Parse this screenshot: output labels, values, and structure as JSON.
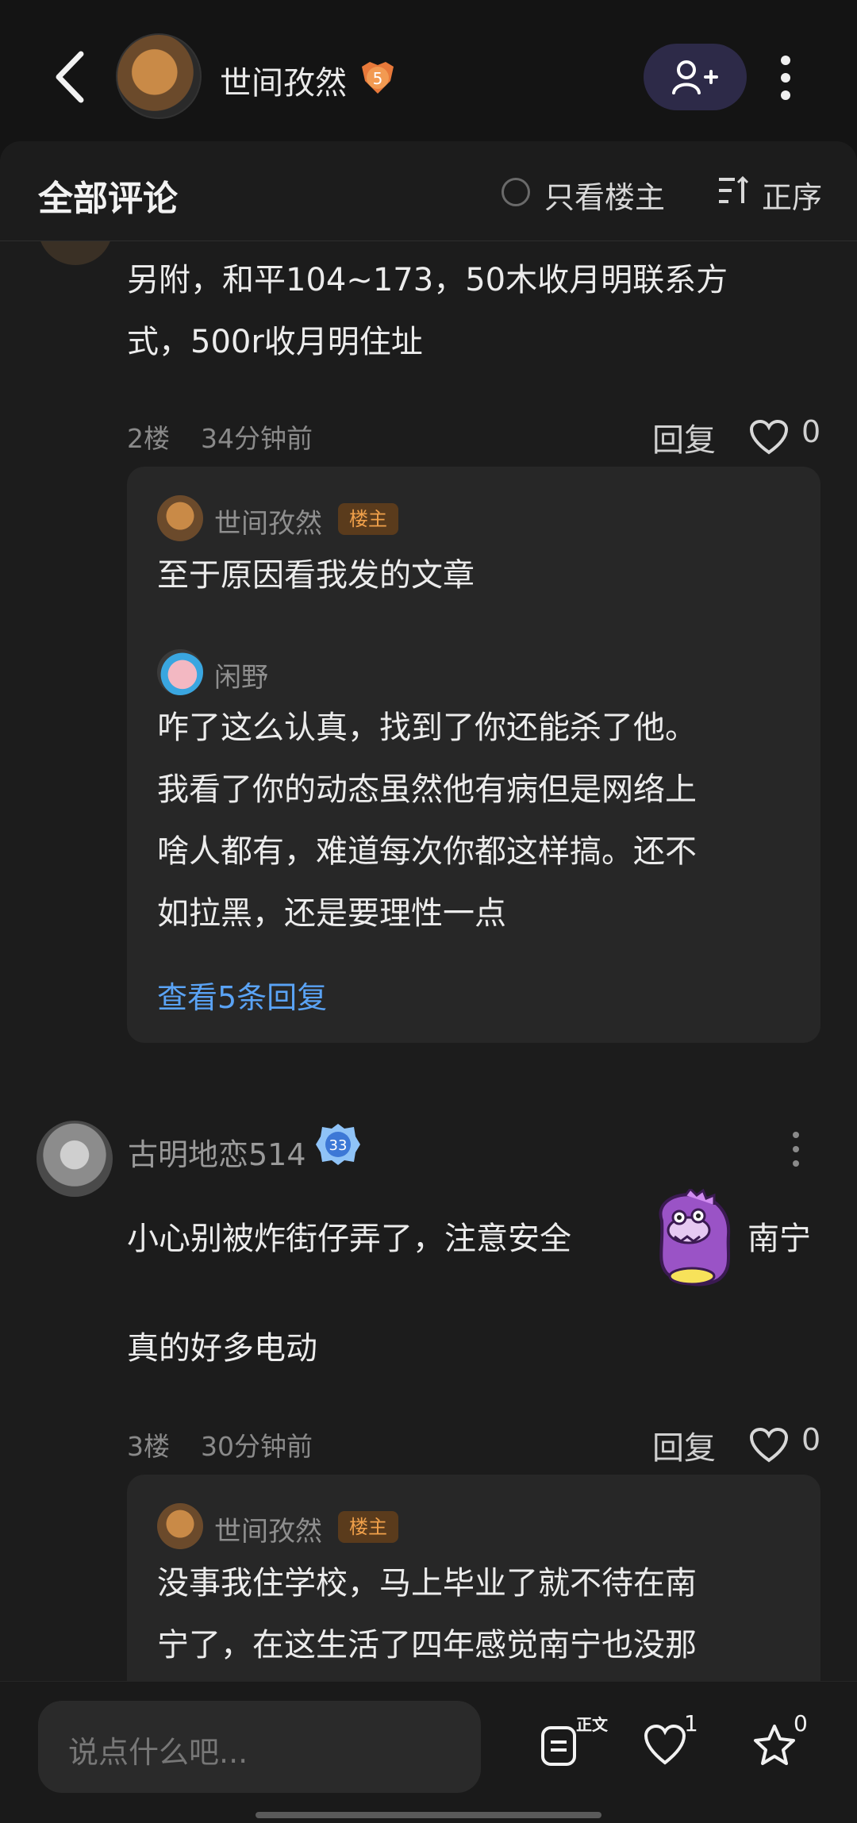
{
  "header": {
    "author_name": "世间孜然",
    "author_level": "5"
  },
  "comments_sheet": {
    "title": "全部评论",
    "only_op_label": "只看楼主",
    "sort_label": "正序"
  },
  "comments": [
    {
      "text_lines": [
        "另附，和平104~173，50木收月明联系方",
        "式，500r收月明住址"
      ],
      "floor": "2楼",
      "time": "34分钟前",
      "reply_label": "回复",
      "likes": "0",
      "replies": [
        {
          "user": "世间孜然",
          "tag": "楼主",
          "text_lines": [
            "至于原因看我发的文章"
          ]
        },
        {
          "user": "闲野",
          "tag": "",
          "text_lines": [
            "咋了这么认真，找到了你还能杀了他。",
            "我看了你的动态虽然他有病但是网络上",
            "啥人都有，难道每次你都这样搞。还不",
            "如拉黑，还是要理性一点"
          ]
        }
      ],
      "view_more": "查看5条回复"
    },
    {
      "user": "古明地恋514",
      "user_level": "33",
      "text_line1_before": "小心别被炸街仔弄了，注意安全",
      "text_line1_after": "南宁",
      "text_line2": "真的好多电动",
      "floor": "3楼",
      "time": "30分钟前",
      "reply_label": "回复",
      "likes": "0",
      "replies": [
        {
          "user": "世间孜然",
          "tag": "楼主",
          "text_lines": [
            "没事我住学校，马上毕业了就不待在南",
            "宁了，在这生活了四年感觉南宁也没那"
          ]
        }
      ]
    }
  ],
  "bottom_bar": {
    "input_placeholder": "说点什么吧...",
    "content_label": "正文",
    "like_count": "1",
    "fav_count": "0"
  },
  "colors": {
    "background": "#141414",
    "sheet": "#1c1c1c",
    "reply_box": "#272727",
    "link_blue": "#5aa3f5",
    "op_tag_text": "#f0a04a",
    "follow_button": "#2d2a48"
  },
  "icons": [
    "back-arrow-icon",
    "add-friend-icon",
    "more-vertical-icon",
    "radio-icon",
    "sort-icon",
    "heart-icon",
    "content-icon",
    "star-icon"
  ]
}
